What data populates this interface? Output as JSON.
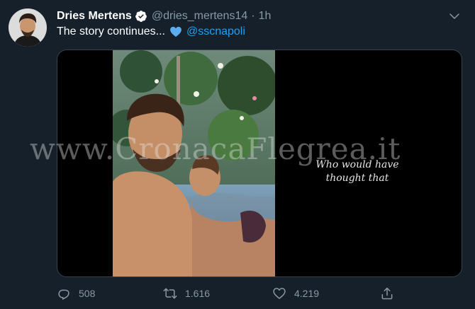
{
  "tweet": {
    "author": {
      "name": "Dries Mertens",
      "handle": "@dries_mertens14",
      "verified": true
    },
    "separator": "·",
    "time": "1h",
    "text": "The story continues...",
    "emoji": "blue-heart",
    "mention": "@sscnapoli",
    "media": {
      "caption": "Who would have\nthought that"
    },
    "watermark": "www.CronacaFlegrea.it",
    "stats": {
      "replies": "508",
      "retweets": "1.616",
      "likes": "4.219"
    }
  },
  "colors": {
    "background": "#15202b",
    "text": "#ffffff",
    "muted": "#8899a6",
    "accent": "#1da1f2",
    "border": "#38444d"
  },
  "icons": {
    "verified": "verified-badge-icon",
    "menu": "chevron-down-icon",
    "reply": "reply-icon",
    "retweet": "retweet-icon",
    "like": "heart-icon",
    "share": "share-icon"
  }
}
